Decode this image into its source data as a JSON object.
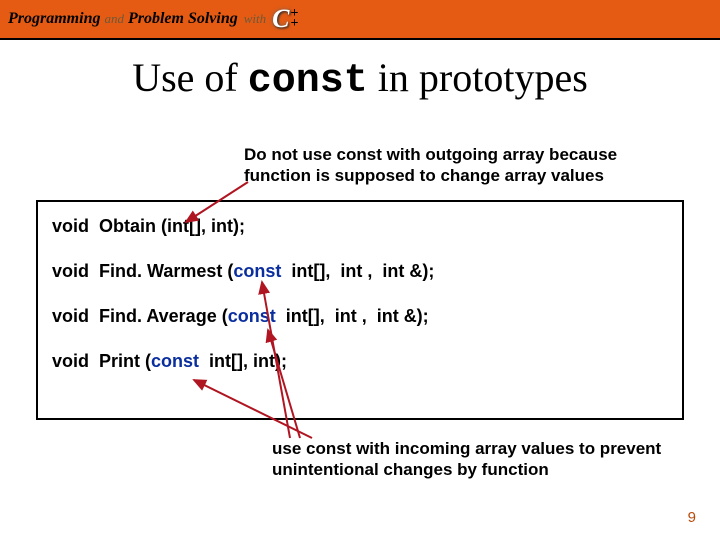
{
  "header": {
    "text1": "Programming",
    "and": "and",
    "text2": "Problem Solving",
    "with": "with",
    "cpp_c": "C",
    "cpp_plus1": "+",
    "cpp_plus2": "+"
  },
  "title": {
    "pre": "Use of ",
    "kw": "const",
    "post": " in prototypes"
  },
  "notes": {
    "top": "Do not use const with outgoing array because function is supposed to change array values",
    "bottom": "use const with incoming array values to prevent unintentional changes by function"
  },
  "code": {
    "l1_a": "void  Obtain (int[], int);",
    "l2_a": "void  Find. Warmest (",
    "l2_c": "const",
    "l2_b": "  int[],  int ,  int &);",
    "l3_a": "void  Find. Average (",
    "l3_c": "const",
    "l3_b": "  int[],  int ,  int &);",
    "l4_a": "void  Print (",
    "l4_c": "const",
    "l4_b": "  int[], int);"
  },
  "page_number": "9"
}
